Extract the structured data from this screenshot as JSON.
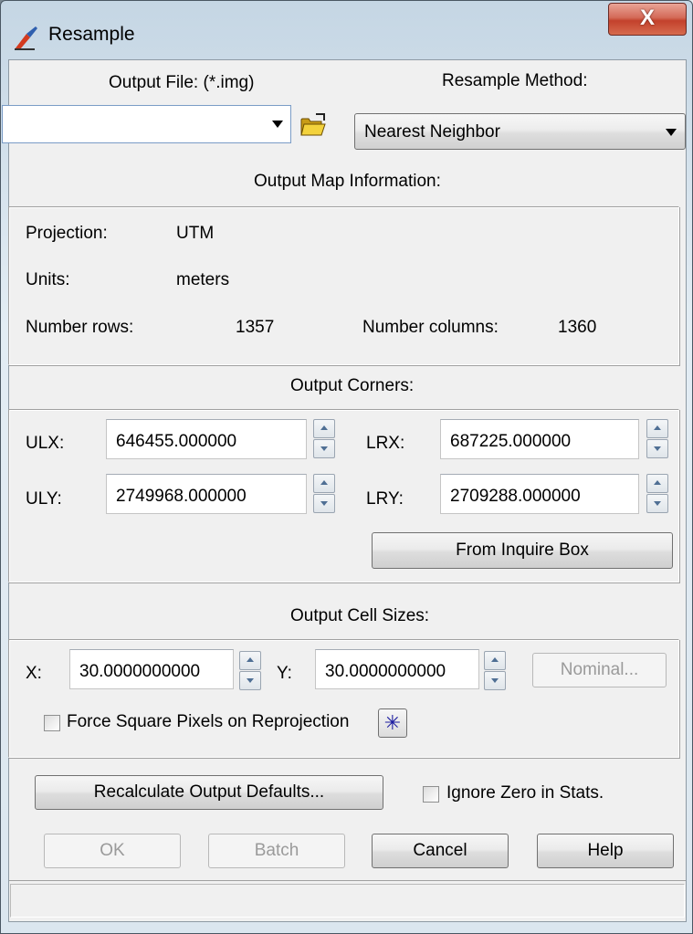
{
  "window": {
    "title": "Resample",
    "close_glyph": "X",
    "icon": "resample-app-icon",
    "accent_color": "#c3412c"
  },
  "output_file": {
    "label": "Output File: (*.img)",
    "value": "",
    "folder_icon": "open-folder-icon"
  },
  "resample_method": {
    "label": "Resample Method:",
    "selected": "Nearest Neighbor"
  },
  "map_info": {
    "heading": "Output Map Information:",
    "projection_label": "Projection:",
    "projection_value": "UTM",
    "units_label": "Units:",
    "units_value": "meters",
    "rows_label": "Number rows:",
    "rows_value": "1357",
    "columns_label": "Number columns:",
    "columns_value": "1360"
  },
  "corners": {
    "heading": "Output Corners:",
    "ulx_label": "ULX:",
    "ulx_value": "646455.000000",
    "uly_label": "ULY:",
    "uly_value": "2749968.000000",
    "lrx_label": "LRX:",
    "lrx_value": "687225.000000",
    "lry_label": "LRY:",
    "lry_value": "2709288.000000",
    "from_inquire_label": "From Inquire Box"
  },
  "cell_sizes": {
    "heading": "Output Cell Sizes:",
    "x_label": "X:",
    "x_value": "30.0000000000",
    "y_label": "Y:",
    "y_value": "30.0000000000",
    "nominal_label": "Nominal...",
    "force_square_label": "Force Square Pixels on Reprojection",
    "force_square_checked": false,
    "star_glyph": "✳"
  },
  "options": {
    "recalculate_label": "Recalculate Output Defaults...",
    "ignore_zero_label": "Ignore Zero in Stats.",
    "ignore_zero_checked": false
  },
  "actions": {
    "ok_label": "OK",
    "batch_label": "Batch",
    "cancel_label": "Cancel",
    "help_label": "Help"
  },
  "statusbar": {
    "text": ""
  }
}
